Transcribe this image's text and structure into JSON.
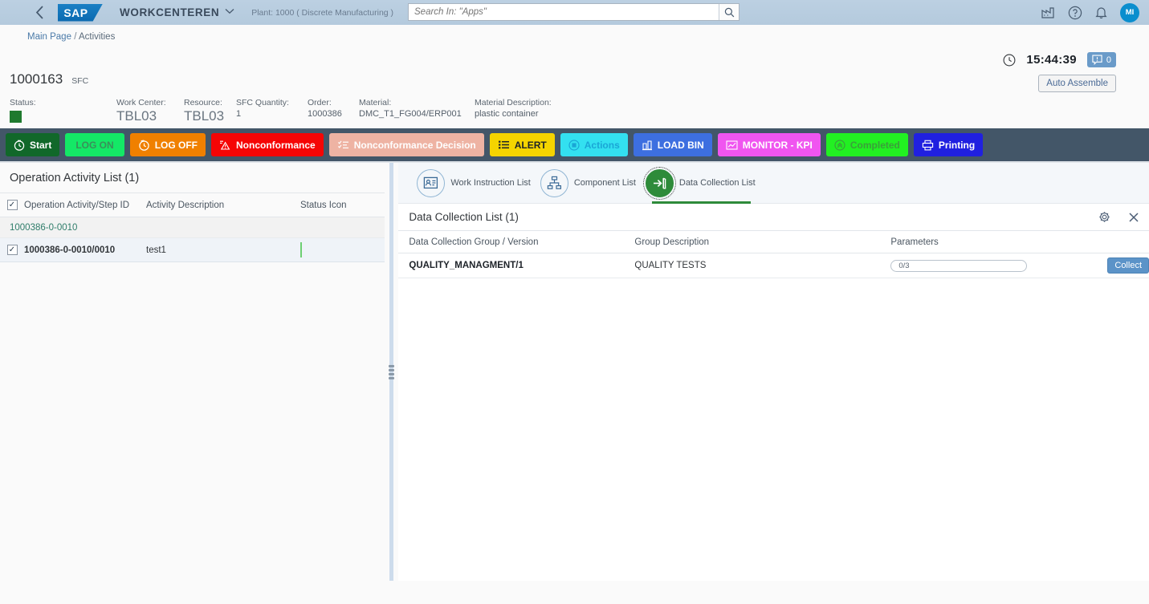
{
  "shell": {
    "back_icon": "chevron-left-icon",
    "logo_text": "SAP",
    "app_title": "WORKCENTEREN",
    "plant_info": "Plant: 1000 ( Discrete Manufacturing )",
    "search_placeholder": "Search In: \"Apps\"",
    "search_value": "",
    "avatar_initials": "MI",
    "icons": [
      "factory-icon",
      "help-icon",
      "bell-icon"
    ]
  },
  "breadcrumb": {
    "main": "Main Page",
    "separator": "/",
    "current": "Activities"
  },
  "statusbar": {
    "clock_icon": "clock-icon",
    "time": "15:44:39",
    "message_icon": "message-icon",
    "message_count": "0"
  },
  "sfc": {
    "number": "1000163",
    "label": "SFC",
    "auto_assemble_label": "Auto Assemble",
    "fields": [
      {
        "label": "Status:",
        "value": "",
        "type": "status-square",
        "color": "#1f7a2e"
      },
      {
        "label": "Work Center:",
        "value": "TBL03",
        "type": "big"
      },
      {
        "label": "Resource:",
        "value": "TBL03",
        "type": "big"
      },
      {
        "label": "SFC Quantity:",
        "value": "1",
        "type": "normal"
      },
      {
        "label": "Order:",
        "value": "1000386",
        "type": "normal"
      },
      {
        "label": "Material:",
        "value": "DMC_T1_FG004/ERP001",
        "type": "normal"
      },
      {
        "label": "Material Description:",
        "value": "plastic container",
        "type": "normal"
      }
    ]
  },
  "toolbar": {
    "background": "#435668",
    "buttons": [
      {
        "label": "Start",
        "icon": "clock-start-icon",
        "bg": "#11682a",
        "fg": "#ffffff"
      },
      {
        "label": "LOG ON",
        "icon": "",
        "bg": "#14e866",
        "fg": "#3a8f5a"
      },
      {
        "label": "LOG OFF",
        "icon": "clock-off-icon",
        "bg": "#f08000",
        "fg": "#ffffff"
      },
      {
        "label": "Nonconformance",
        "icon": "warning-icon",
        "bg": "#f50505",
        "fg": "#ffffff"
      },
      {
        "label": "Nonconformance Decision",
        "icon": "list-check-icon",
        "bg": "#eeb3a3",
        "fg": "#ffffff"
      },
      {
        "label": "ALERT",
        "icon": "list-icon",
        "bg": "#f5d400",
        "fg": "#1d2228"
      },
      {
        "label": "Actions",
        "icon": "circle-dot-icon",
        "bg": "#33e0f0",
        "fg": "#1aa6d6"
      },
      {
        "label": "LOAD BIN",
        "icon": "bin-icon",
        "bg": "#3d6fe0",
        "fg": "#ffffff"
      },
      {
        "label": "MONITOR - KPI",
        "icon": "kpi-icon",
        "bg": "#f055f0",
        "fg": "#ffffff"
      },
      {
        "label": "Completed",
        "icon": "check-circle-icon",
        "bg": "#22f022",
        "fg": "#3aa03a"
      },
      {
        "label": "Printing",
        "icon": "printer-icon",
        "bg": "#2020e0",
        "fg": "#ffffff"
      }
    ]
  },
  "left_panel": {
    "title": "Operation Activity List (1)",
    "select_all_checked": true,
    "columns": [
      "Operation Activity/Step ID",
      "Activity Description",
      "Status Icon"
    ],
    "group_row": {
      "id": "1000386-0-0010"
    },
    "rows": [
      {
        "checked": true,
        "id": "1000386-0-0010/0010",
        "description": "test1",
        "status_color": "#2d8031"
      }
    ]
  },
  "right_panel": {
    "tabs": [
      {
        "label": "Work Instruction List",
        "icon": "work-instruction-icon",
        "active": false
      },
      {
        "label": "Component List",
        "icon": "component-tree-icon",
        "active": false
      },
      {
        "label": "Data Collection List",
        "icon": "data-collection-icon",
        "active": true
      }
    ],
    "card": {
      "title": "Data Collection List (1)",
      "settings_icon": "gear-icon",
      "close_icon": "close-icon",
      "columns": [
        "Data Collection Group / Version",
        "Group Description",
        "Parameters",
        ""
      ],
      "rows": [
        {
          "group_version": "QUALITY_MANAGMENT/1",
          "group_description": "QUALITY TESTS",
          "parameters_value": "0/3",
          "action_label": "Collect"
        }
      ]
    }
  }
}
